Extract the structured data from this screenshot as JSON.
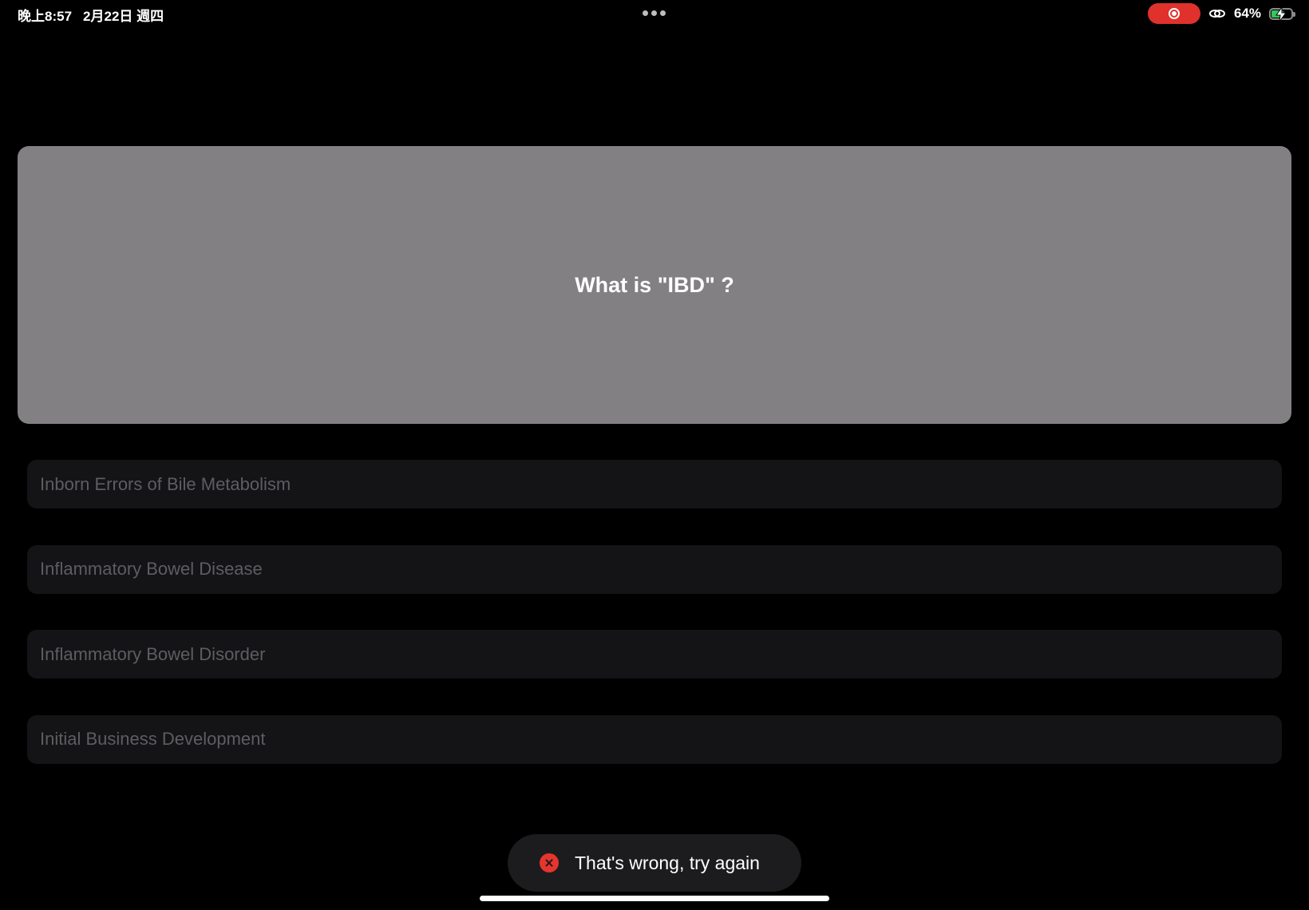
{
  "status_bar": {
    "time": "晚上8:57",
    "date": "2月22日 週四",
    "battery_percent": "64%",
    "battery_level": 0.64,
    "recording_active": true,
    "icons": [
      "multitask-dots-icon",
      "screen-record-icon",
      "link-icon",
      "battery-icon",
      "charging-bolt-icon"
    ]
  },
  "question": {
    "text": "What is \"IBD\" ?"
  },
  "answers": [
    {
      "label": "Inborn Errors of Bile Metabolism"
    },
    {
      "label": "Inflammatory Bowel Disease"
    },
    {
      "label": "Inflammatory Bowel Disorder"
    },
    {
      "label": "Initial Business Development"
    }
  ],
  "toast": {
    "icon": "error-x-icon",
    "message": "That's wrong, try again"
  },
  "colors": {
    "background": "#000000",
    "question_card": "#828083",
    "answer_bg": "#141416",
    "answer_text": "#5d5d62",
    "error": "#e5352e",
    "record": "#e0312c",
    "battery": "#34c759"
  }
}
